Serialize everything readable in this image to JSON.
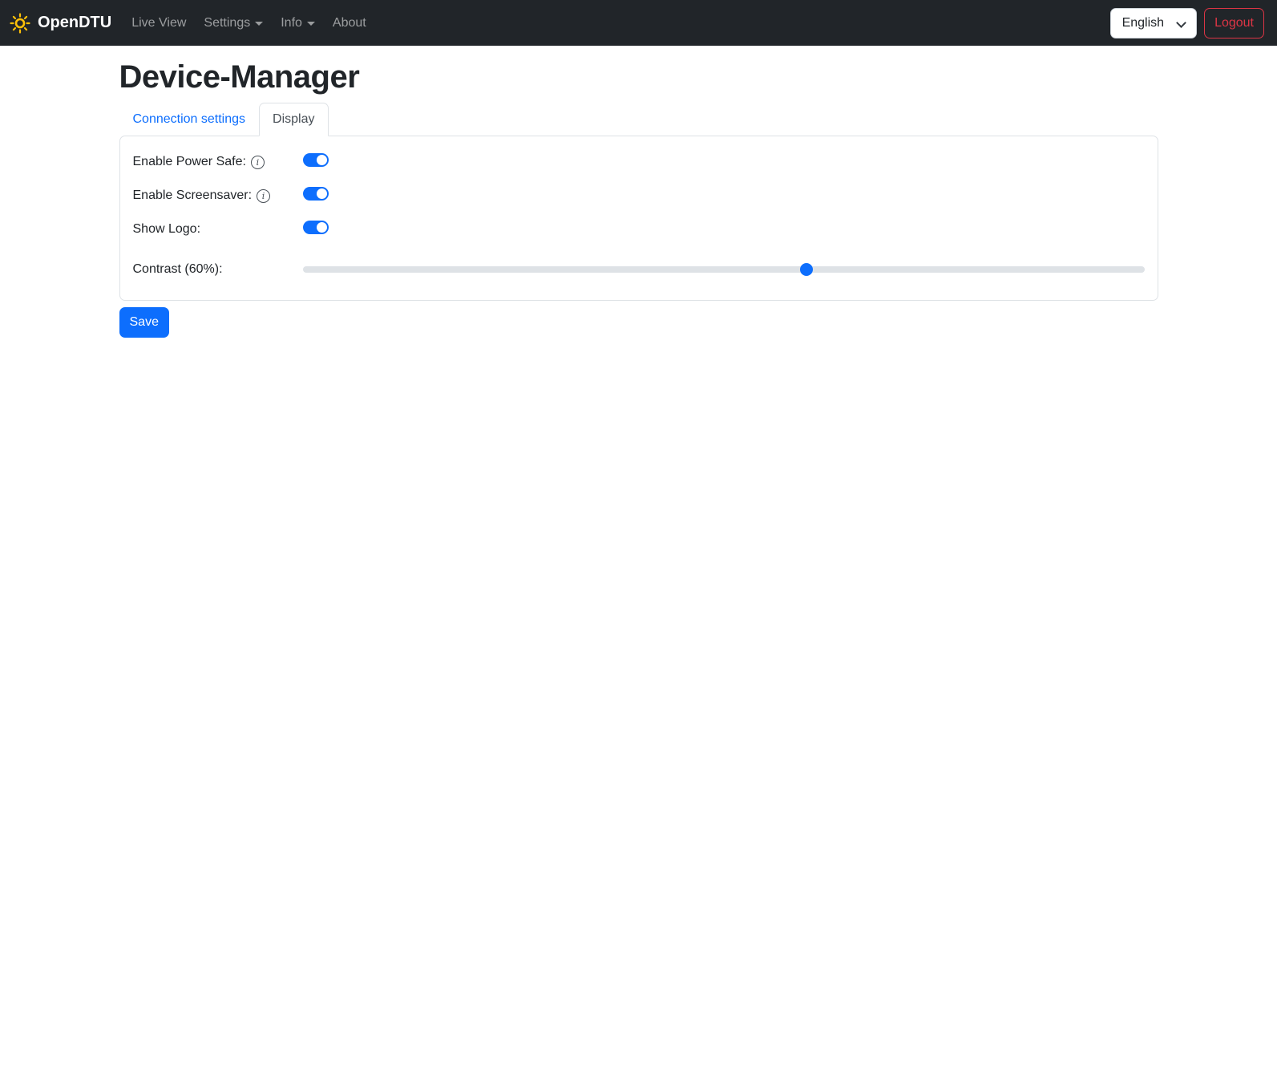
{
  "navbar": {
    "brand": "OpenDTU",
    "items": [
      {
        "label": "Live View",
        "dropdown": false
      },
      {
        "label": "Settings",
        "dropdown": true
      },
      {
        "label": "Info",
        "dropdown": true
      },
      {
        "label": "About",
        "dropdown": false
      }
    ],
    "language_selected": "English",
    "logout_label": "Logout"
  },
  "page": {
    "title": "Device-Manager"
  },
  "tabs": [
    {
      "label": "Connection settings",
      "active": false
    },
    {
      "label": "Display",
      "active": true
    }
  ],
  "form": {
    "rows": [
      {
        "label": "Enable Power Safe:",
        "info": true,
        "type": "switch",
        "on": true
      },
      {
        "label": "Enable Screensaver:",
        "info": true,
        "type": "switch",
        "on": true
      },
      {
        "label": "Show Logo:",
        "info": false,
        "type": "switch",
        "on": true
      },
      {
        "label": "Contrast (60%):",
        "info": false,
        "type": "range",
        "value": 60
      }
    ],
    "info_glyph": "i",
    "save_label": "Save"
  },
  "colors": {
    "navbar_bg": "#212529",
    "accent": "#0d6efd",
    "danger": "#dc3545",
    "sun": "#ffc107",
    "border": "#dee2e6"
  }
}
